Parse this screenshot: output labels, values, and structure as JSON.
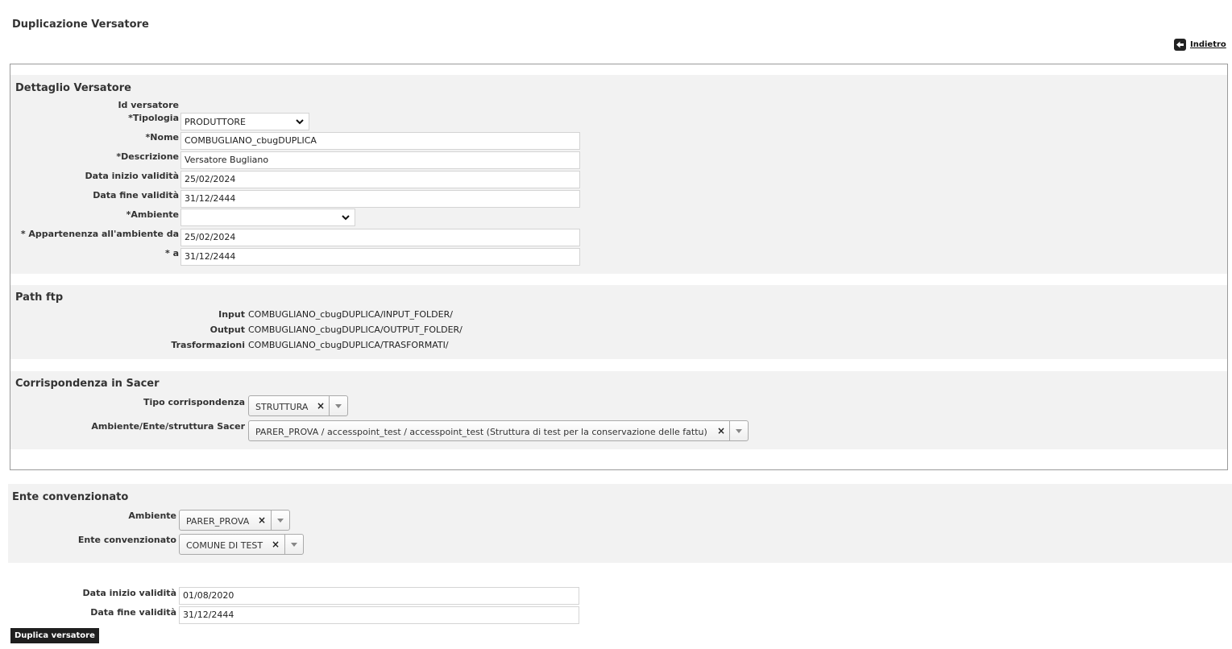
{
  "page": {
    "title": "Duplicazione Versatore",
    "back_label": "Indietro"
  },
  "dettaglio": {
    "title": "Dettaglio Versatore",
    "id_label": "Id versatore",
    "tipologia_label": "*Tipologia",
    "tipologia_value": "PRODUTTORE",
    "nome_label": "*Nome",
    "nome_value": "COMBUGLIANO_cbugDUPLICA",
    "descrizione_label": "*Descrizione",
    "descrizione_value": "Versatore Bugliano",
    "data_inizio_label": "Data inizio validità",
    "data_inizio_value": "25/02/2024",
    "data_fine_label": "Data fine validità",
    "data_fine_value": "31/12/2444",
    "ambiente_label": "*Ambiente",
    "ambiente_value": "",
    "appartenenza_label": "* Appartenenza all'ambiente da",
    "appartenenza_value": "25/02/2024",
    "a_label": "* a",
    "a_value": "31/12/2444"
  },
  "path_ftp": {
    "title": "Path ftp",
    "input_label": "Input",
    "input_value": "COMBUGLIANO_cbugDUPLICA/INPUT_FOLDER/",
    "output_label": "Output",
    "output_value": "COMBUGLIANO_cbugDUPLICA/OUTPUT_FOLDER/",
    "trasf_label": "Trasformazioni",
    "trasf_value": "COMBUGLIANO_cbugDUPLICA/TRASFORMATI/"
  },
  "corrispondenza": {
    "title": "Corrispondenza in Sacer",
    "tipo_label": "Tipo corrispondenza",
    "tipo_value": "STRUTTURA",
    "struttura_label": "Ambiente/Ente/struttura Sacer",
    "struttura_value": "PARER_PROVA / accesspoint_test / accesspoint_test (Struttura di test per la conservazione delle fattu)"
  },
  "ente": {
    "title": "Ente convenzionato",
    "ambiente_label": "Ambiente",
    "ambiente_value": "PARER_PROVA",
    "ente_label": "Ente convenzionato",
    "ente_value": "COMUNE DI TEST"
  },
  "validita": {
    "data_inizio_label": "Data inizio validità",
    "data_inizio_value": "01/08/2020",
    "data_fine_label": "Data fine validità",
    "data_fine_value": "31/12/2444"
  },
  "actions": {
    "duplica_label": "Duplica versatore",
    "clear_symbol": "×"
  }
}
